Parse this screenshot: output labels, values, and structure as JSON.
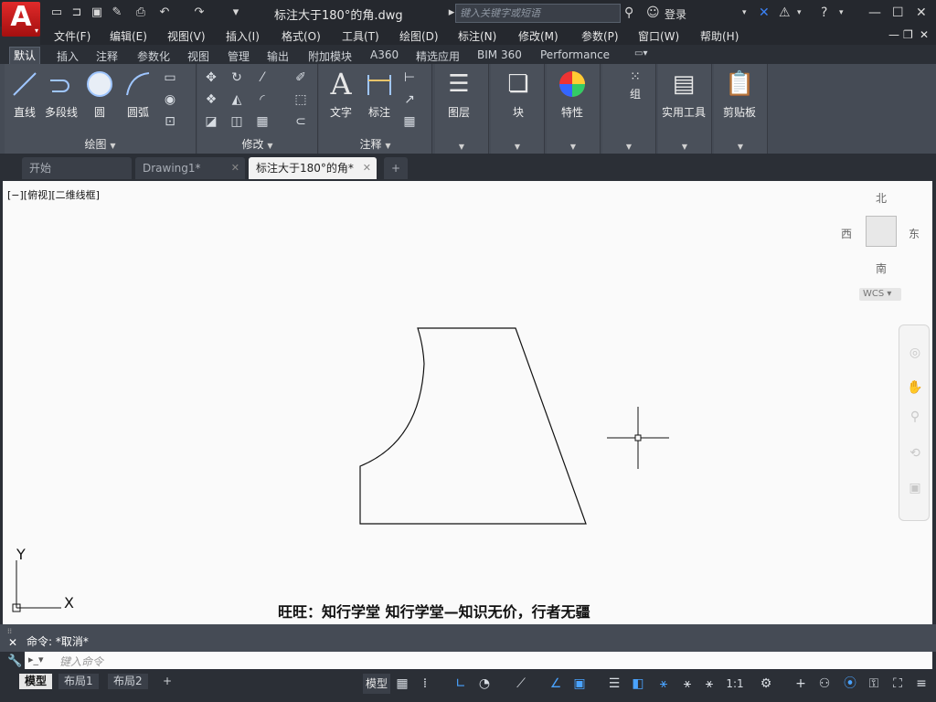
{
  "title": {
    "document": "标注大于180°的角.dwg",
    "search_placeholder": "键入关键字或短语",
    "login": "登录"
  },
  "menu": [
    "文件(F)",
    "编辑(E)",
    "视图(V)",
    "插入(I)",
    "格式(O)",
    "工具(T)",
    "绘图(D)",
    "标注(N)",
    "修改(M)",
    "参数(P)",
    "窗口(W)",
    "帮助(H)"
  ],
  "ribbon_tabs": [
    "默认",
    "插入",
    "注释",
    "参数化",
    "视图",
    "管理",
    "输出",
    "附加模块",
    "A360",
    "精选应用",
    "BIM 360",
    "Performance"
  ],
  "ribbon": {
    "draw": {
      "title": "绘图",
      "line": "直线",
      "polyline": "多段线",
      "circle": "圆",
      "arc": "圆弧"
    },
    "modify": {
      "title": "修改"
    },
    "annotation": {
      "title": "注释",
      "text": "文字",
      "dimension": "标注"
    },
    "layers": {
      "title": "图层"
    },
    "block": {
      "title": "块"
    },
    "properties": {
      "title": "特性"
    },
    "groups": {
      "title": "组"
    },
    "utilities": {
      "title": "实用工具"
    },
    "clipboard": {
      "title": "剪贴板"
    }
  },
  "doc_tabs": [
    "开始",
    "Drawing1*",
    "标注大于180°的角*"
  ],
  "viewport": {
    "label": "[−][俯视][二维线框]",
    "compass": {
      "north": "北",
      "south": "南",
      "east": "东",
      "west": "西"
    },
    "wcs": "WCS",
    "ucs_x": "X",
    "ucs_y": "Y"
  },
  "watermark": "旺旺：知行学堂 知行学堂—知识无价，行者无疆",
  "command": {
    "history": "命令: *取消*",
    "placeholder": "键入命令"
  },
  "status": {
    "layout_tabs": [
      "模型",
      "布局1",
      "布局2"
    ],
    "model_label": "模型",
    "scale": "1:1"
  },
  "colors": {
    "dark_bg": "#2b2f36",
    "ribbon_bg": "#454b55",
    "canvas_bg": "#fafafa",
    "accent": "#4aa3ff",
    "logo_red": "#d42020"
  }
}
